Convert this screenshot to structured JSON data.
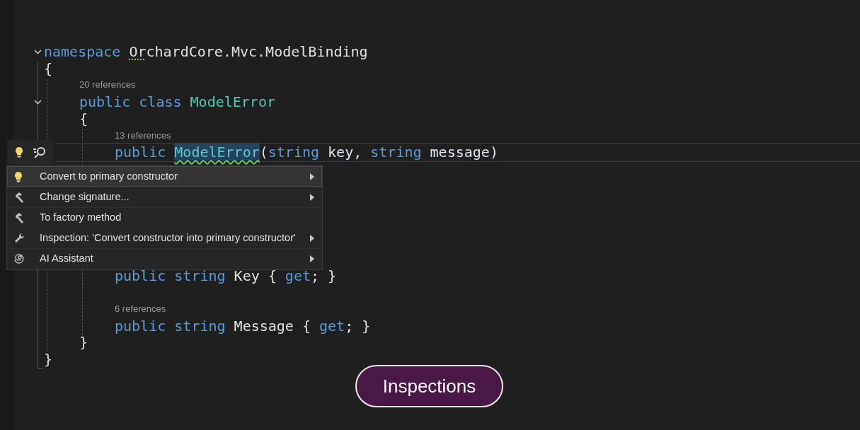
{
  "editor": {
    "rows": [
      {
        "kind": "code",
        "fold": true,
        "tokens": [
          {
            "kind": "keyword",
            "text": "namespace"
          },
          {
            "kind": "hint",
            "text": "Or"
          },
          {
            "kind": "plain",
            "text": "chardCore.Mvc.ModelBinding",
            "join": true
          }
        ]
      },
      {
        "kind": "code",
        "fold": false,
        "tokens": [
          {
            "kind": "plain",
            "text": "{"
          }
        ]
      },
      {
        "kind": "group",
        "children": [
          {
            "kind": "codelens",
            "text": "20 references"
          },
          {
            "kind": "code",
            "fold": true,
            "tokens": [
              {
                "kind": "keyword",
                "text": "public"
              },
              {
                "kind": "keyword",
                "text": "class"
              },
              {
                "kind": "type",
                "text": "ModelError"
              }
            ]
          },
          {
            "kind": "code",
            "fold": false,
            "tokens": [
              {
                "kind": "plain",
                "text": "{"
              }
            ]
          },
          {
            "kind": "group",
            "children": [
              {
                "kind": "codelens",
                "text": "13 references"
              },
              {
                "kind": "code",
                "fold": false,
                "current": true,
                "tokens": [
                  {
                    "kind": "keyword",
                    "text": "public"
                  },
                  {
                    "kind": "selected",
                    "text": "ModelError"
                  },
                  {
                    "kind": "plain",
                    "text": "(",
                    "join": true
                  },
                  {
                    "kind": "keyword",
                    "text": "string",
                    "join": true
                  },
                  {
                    "kind": "param",
                    "text": "key"
                  },
                  {
                    "kind": "plain",
                    "text": ",",
                    "join": true
                  },
                  {
                    "kind": "keyword",
                    "text": "string"
                  },
                  {
                    "kind": "param",
                    "text": "message"
                  },
                  {
                    "kind": "plain",
                    "text": ")",
                    "join": true
                  }
                ]
              },
              {
                "kind": "code",
                "fold": false,
                "tokens": [
                  {
                    "kind": "keyword",
                    "text": "public"
                  },
                  {
                    "kind": "keyword",
                    "text": "string"
                  },
                  {
                    "kind": "plain",
                    "text": "Key"
                  },
                  {
                    "kind": "plain",
                    "text": "{"
                  },
                  {
                    "kind": "keyword",
                    "text": "get"
                  },
                  {
                    "kind": "plain",
                    "text": ";",
                    "join": true
                  },
                  {
                    "kind": "plain",
                    "text": "}"
                  }
                ]
              },
              {
                "kind": "blank"
              },
              {
                "kind": "codelens",
                "text": "6 references"
              },
              {
                "kind": "code",
                "fold": false,
                "tokens": [
                  {
                    "kind": "keyword",
                    "text": "public"
                  },
                  {
                    "kind": "keyword",
                    "text": "string"
                  },
                  {
                    "kind": "plain",
                    "text": "Message"
                  },
                  {
                    "kind": "plain",
                    "text": "{"
                  },
                  {
                    "kind": "keyword",
                    "text": "get"
                  },
                  {
                    "kind": "plain",
                    "text": ";",
                    "join": true
                  },
                  {
                    "kind": "plain",
                    "text": "}"
                  }
                ]
              }
            ]
          },
          {
            "kind": "code",
            "fold": false,
            "tokens": [
              {
                "kind": "plain",
                "text": "}"
              }
            ]
          }
        ]
      },
      {
        "kind": "code",
        "fold": false,
        "tokens": [
          {
            "kind": "plain",
            "text": "}"
          }
        ]
      }
    ]
  },
  "context_menu": {
    "items": [
      {
        "kind": "quickfix",
        "label": "Convert to primary constructor",
        "selected": true,
        "submenu": true
      },
      {
        "kind": "refactoring",
        "label": "Change signature...",
        "selected": false,
        "submenu": true
      },
      {
        "kind": "refactoring",
        "label": "To factory method",
        "selected": false,
        "submenu": false
      },
      {
        "kind": "inspection",
        "label": "Inspection: 'Convert constructor into primary constructor'",
        "selected": false,
        "submenu": true
      },
      {
        "kind": "assistant",
        "label": "AI Assistant",
        "selected": false,
        "submenu": true
      }
    ]
  },
  "caption": "Inspections"
}
